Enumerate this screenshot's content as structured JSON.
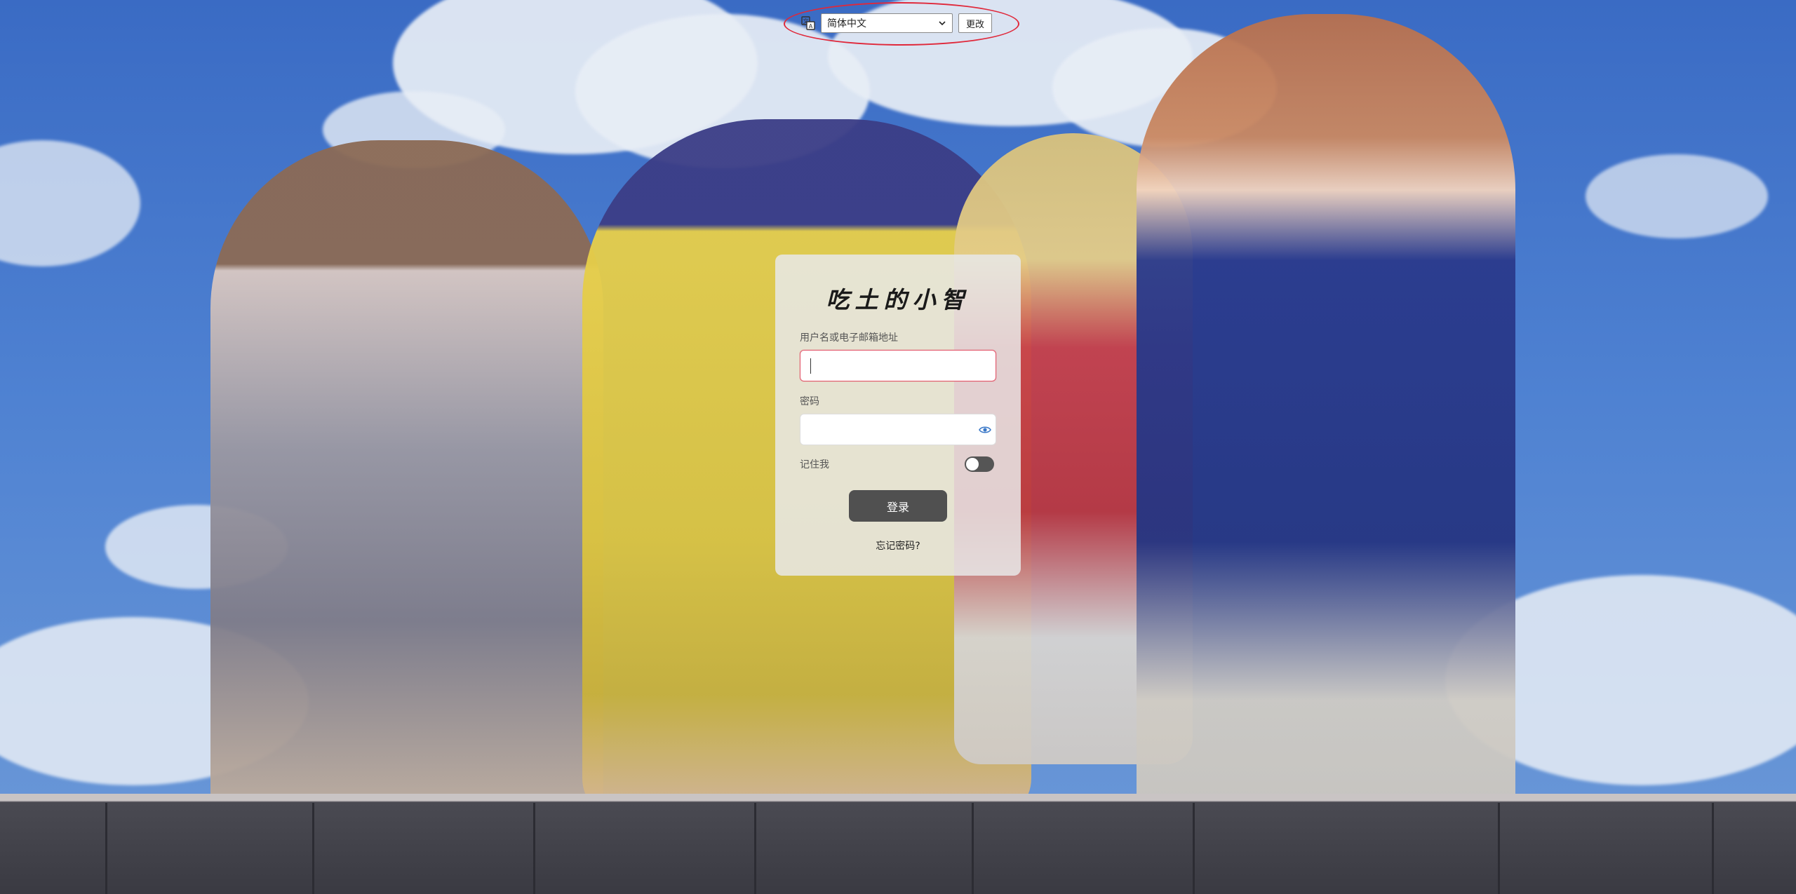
{
  "language_bar": {
    "selected_language": "简体中文",
    "change_label": "更改",
    "translate_icon": "translate-icon",
    "dropdown_icon": "chevron-down-icon"
  },
  "login": {
    "site_title": "吃土的小智",
    "username_label": "用户名或电子邮箱地址",
    "username_value": "",
    "password_label": "密码",
    "password_value": "",
    "password_toggle_icon": "eye-icon",
    "remember_label": "记住我",
    "remember_checked": false,
    "login_label": "登录",
    "forgot_label": "忘记密码?"
  },
  "colors": {
    "card_background": "#e8e8e8",
    "button": "#505050",
    "focus_border": "#e2566a",
    "annotation": "#e0283a",
    "sky": "#3a6bc4"
  }
}
